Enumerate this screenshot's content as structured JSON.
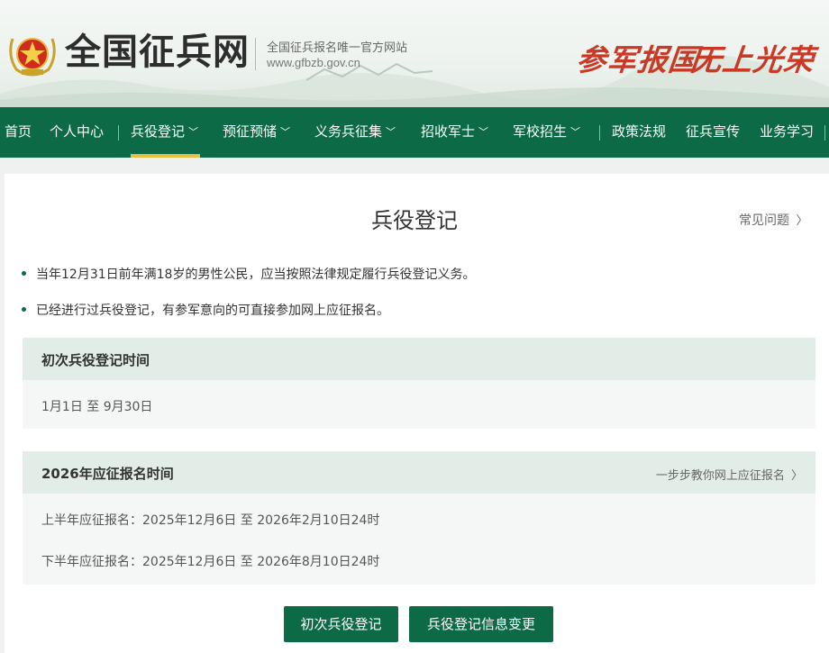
{
  "header": {
    "site_title": "全国征兵网",
    "subtitle": "全国征兵报名唯一官方网站",
    "domain": "www.gfbzb.gov.cn",
    "slogan_1": "参军报国",
    "slogan_2": "无上光荣"
  },
  "nav": {
    "items": [
      {
        "label": "首页"
      },
      {
        "label": "个人中心"
      },
      {
        "label": "兵役登记",
        "active": true
      },
      {
        "label": "预征预储"
      },
      {
        "label": "义务兵征集"
      },
      {
        "label": "招收军士"
      },
      {
        "label": "军校招生"
      },
      {
        "label": "政策法规"
      },
      {
        "label": "征兵宣传"
      },
      {
        "label": "业务学习"
      }
    ],
    "chevron": "chevron-down-icon"
  },
  "main": {
    "title": "兵役登记",
    "faq_link": "常见问题",
    "bullets": [
      "当年12月31日前年满18岁的男性公民，应当按照法律规定履行兵役登记义务。",
      "已经进行过兵役登记，有参军意向的可直接参加网上应征报名。"
    ],
    "card_first": {
      "title": "初次兵役登记时间",
      "value": "1月1日 至 9月30日"
    },
    "card_2026": {
      "title": "2026年应征报名时间",
      "link": "一步步教你网上应征报名",
      "rows": [
        "上半年应征报名：2025年12月6日 至 2026年2月10日24时",
        "下半年应征报名：2025年12月6日 至 2026年8月10日24时"
      ]
    },
    "buttons": {
      "first_registration": "初次兵役登记",
      "info_change": "兵役登记信息变更"
    }
  },
  "colors": {
    "brand_green": "#0c6a47",
    "nav_active_underline": "#e6c045",
    "slogan_red": "#c93a26",
    "card_head_bg": "#e3ede7"
  }
}
